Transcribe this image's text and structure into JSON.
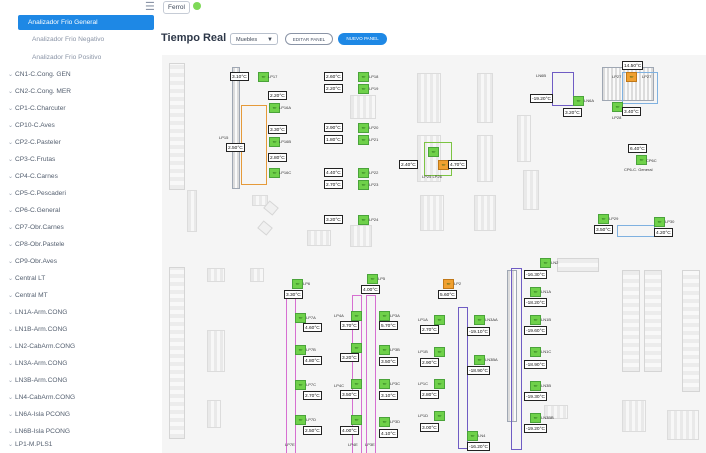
{
  "sidebar": {
    "items": [
      {
        "label": "Analizador Frio General",
        "active": true
      },
      {
        "label": "Analizador Frio Negativo"
      },
      {
        "label": "Analizador Frio Positivo"
      },
      {
        "label": "CN1-C.Cong. GEN"
      },
      {
        "label": "CN2-C.Cong. MER"
      },
      {
        "label": "CP1-C.Charcuter"
      },
      {
        "label": "CP10-C.Aves"
      },
      {
        "label": "CP2-C.Pasteler"
      },
      {
        "label": "CP3-C.Frutas"
      },
      {
        "label": "CP4-C.Carnes"
      },
      {
        "label": "CP5-C.Pescaderi"
      },
      {
        "label": "CP6-C.General"
      },
      {
        "label": "CP7-Obr.Carnes"
      },
      {
        "label": "CP8-Obr.Pastele"
      },
      {
        "label": "CP9-Obr.Aves"
      },
      {
        "label": "Central LT"
      },
      {
        "label": "Central MT"
      },
      {
        "label": "LN1A-Arm.CONG"
      },
      {
        "label": "LN1B-Arm.CONG"
      },
      {
        "label": "LN2-CabArm.CONG"
      },
      {
        "label": "LN3A-Arm.CONG"
      },
      {
        "label": "LN3B-Arm.CONG"
      },
      {
        "label": "LN4-CabArm.CONG"
      },
      {
        "label": "LN6A-Isla PCONG"
      },
      {
        "label": "LN6B-Isla PCONG"
      },
      {
        "label": "LP1-M.PLS1"
      }
    ]
  },
  "header": {
    "store": "Ferrol",
    "store_status_color": "#7ed957",
    "title": "Tiempo Real",
    "select_value": "Muebles",
    "edit_button": "EDITAR PANEL",
    "new_button": "NUEVO PANEL"
  },
  "colors": {
    "accent": "#1e88e5",
    "sensor_ok": "#6fd14a",
    "sensor_warn": "#f0a030"
  },
  "readings": {
    "lp17": "3.10°C",
    "lp18": "2.60°C",
    "lp19": "2.20°C",
    "lp16a_t": "2.20°C",
    "lp16a": "LP16A",
    "lp16b_t": "3.30°C",
    "lp16b": "LP16B",
    "lp16c_t": "2.80°C",
    "lp16c": "LP16C",
    "lp15_t": "2.50°C",
    "lp15": "LP15",
    "lp20": "2.90°C",
    "lp21": "1.80°C",
    "lp22": "4.40°C",
    "lp23": "2.70°C",
    "lp24": "3.20°C",
    "lp25_a": "2.40°C",
    "lp25_b": "4.70°C",
    "lp25_26": "LP25 LP26",
    "ln6a_t": "-19.20°C",
    "ln6a": "LN6A",
    "ln6b": "LN6B",
    "ln6b_t": "3.20°C",
    "lp27_t": "14.50°C",
    "lp27": "LP27",
    "lp28_t": "3.40°C",
    "lp28": "LP28",
    "cp6_t": "6.40°C",
    "cp6": "CP6-C. General",
    "lp29_t": "3.50°C",
    "lp29": "LP29",
    "lp30": "LP30",
    "lp30_t": "4.20°C",
    "ln2": "LN2",
    "ln2_t": "-16.30°C",
    "ln1a": "LN1A",
    "ln1a_t": "-18.20°C",
    "ln1b": "LN1B",
    "ln1b_t": "-19.60°C",
    "ln1c": "LN1C",
    "ln1c_t": "-18.90°C",
    "ln3b": "LN3B",
    "ln3b_t": "-19.30°C",
    "ln3ba": "LN3BA",
    "ln3bb": "LN3BB",
    "ln3aa": "LN3AA",
    "ln3a_t": "-19.10°C",
    "ln3ab_t": "-18.90°C",
    "ln3bc_t": "-19.20°C",
    "ln4": "LN4",
    "ln4_t": "-16.20°C",
    "lp6": "LP6",
    "lp6_t": "3.30°C",
    "lp5": "LP5",
    "lp5_t": "4.00°C",
    "lp2": "LP2",
    "lp2_t": "5.60°C",
    "lp7a": "LP7A",
    "lp7a_t": "4.60°C",
    "lp4a": "LP4A",
    "lp4a_t": "3.70°C",
    "lp3a": "LP3A",
    "lp3a_t": "5.70°C",
    "lp1a": "LP1A",
    "lp1a_t": "2.70°C",
    "lp7b": "LP7B",
    "lp7b_t": "4.80°C",
    "lp4b_t": "3.20°C",
    "lp3b": "LP3B",
    "lp3b_t": "3.50°C",
    "lp1b": "LP1B",
    "lp1b_t": "2.90°C",
    "lp7c": "LP7C",
    "lp7c_t": "2.70°C",
    "lp4c_t": "3.50°C",
    "lp3c": "LP3C",
    "lp3c_t": "3.10°C",
    "lp1c_t": "2.80°C",
    "lp7d": "LP7D",
    "lp7d_t": "2.50°C",
    "lp4d_t": "4.00°C",
    "lp3d": "LP3D",
    "lp3d_t": "4.10°C",
    "lp1d_t": "3.00°C",
    "lp7e": "LP7E",
    "lp4e": "LP4E",
    "lp3e": "LP3E",
    "lp1e": "LP1E"
  }
}
